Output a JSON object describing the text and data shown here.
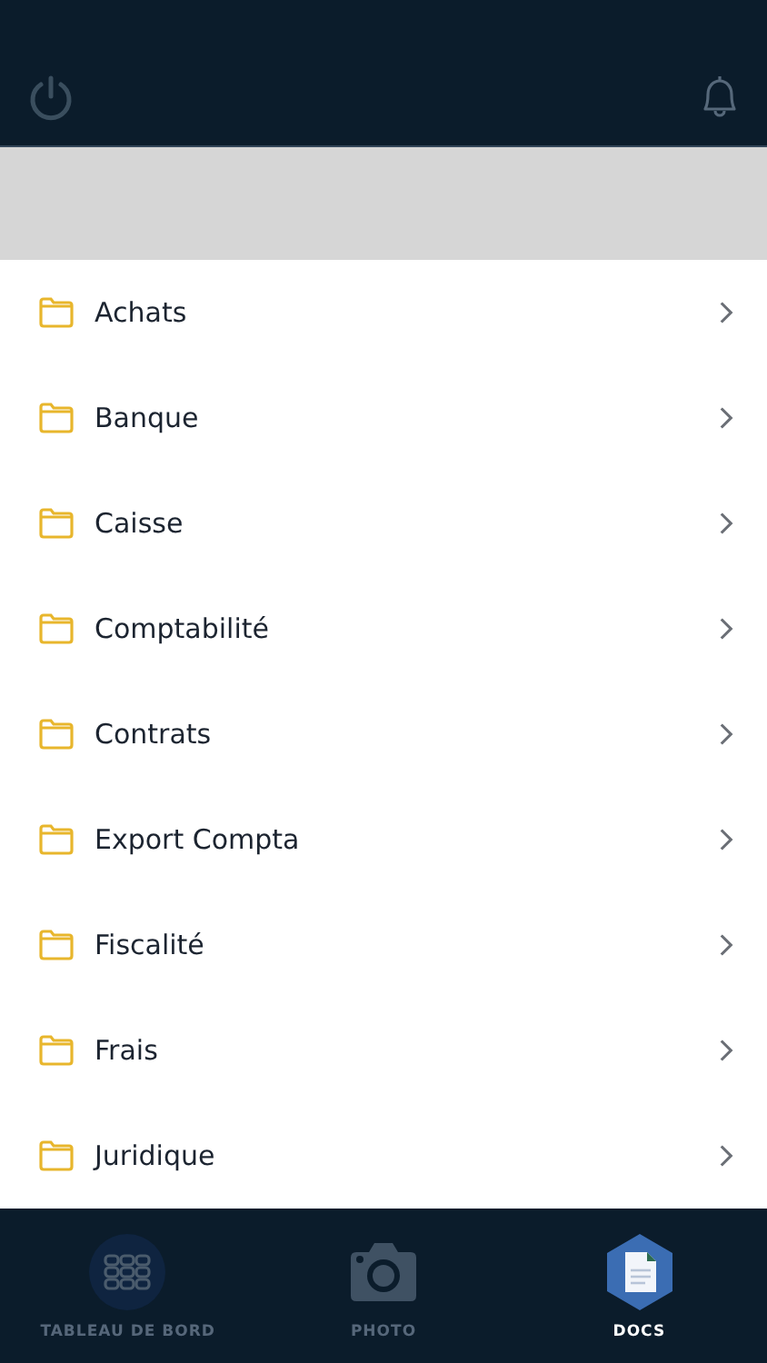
{
  "folders": [
    {
      "name": "Achats"
    },
    {
      "name": "Banque"
    },
    {
      "name": "Caisse"
    },
    {
      "name": "Comptabilité"
    },
    {
      "name": "Contrats"
    },
    {
      "name": "Export Compta"
    },
    {
      "name": "Fiscalité"
    },
    {
      "name": "Frais"
    },
    {
      "name": "Juridique"
    }
  ],
  "tabs": [
    {
      "label": "TABLEAU DE BORD",
      "kind": "grid",
      "selected": false
    },
    {
      "label": "PHOTO",
      "kind": "camera",
      "selected": false
    },
    {
      "label": "DOCS",
      "kind": "document",
      "selected": true
    }
  ]
}
